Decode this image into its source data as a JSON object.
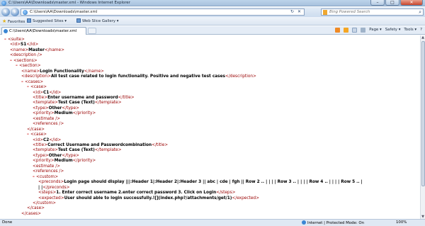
{
  "window": {
    "title": "C:\\Users\\AA\\Downloads\\master.xml - Windows Internet Explorer",
    "minimize": "–",
    "maximize": "□",
    "close": "✕"
  },
  "address": {
    "url": "C:\\Users\\AA\\Downloads\\master.xml",
    "refresh": "↻",
    "stop": "✕"
  },
  "search": {
    "placeholder": "Bing Powered Search"
  },
  "favorites": {
    "label": "Favorites",
    "suggested": "Suggested Sites ▾",
    "gallery": "Web Slice Gallery ▾"
  },
  "tab": {
    "label": "C:\\Users\\AA\\Downloads\\master.xml"
  },
  "commands": {
    "page": "Page ▾",
    "safety": "Safety ▾",
    "tools": "Tools ▾",
    "help": "?"
  },
  "xml": {
    "lines": [
      {
        "minus": "–",
        "indent": 0,
        "tag_open": "<suite>",
        "text": "",
        "tag_close": ""
      },
      {
        "minus": "",
        "indent": 1,
        "tag_open": "<id>",
        "text": "S1",
        "tag_close": "</id>"
      },
      {
        "minus": "",
        "indent": 1,
        "tag_open": "<name>",
        "text": "Master",
        "tag_close": "</name>"
      },
      {
        "minus": "",
        "indent": 1,
        "tag_open": "<description />",
        "text": "",
        "tag_close": ""
      },
      {
        "minus": "–",
        "indent": 1,
        "tag_open": "<sections>",
        "text": "",
        "tag_close": ""
      },
      {
        "minus": "–",
        "indent": 2,
        "tag_open": "<section>",
        "text": "",
        "tag_close": ""
      },
      {
        "minus": "",
        "indent": 3,
        "tag_open": "<name>",
        "text": "Login Functionality",
        "tag_close": "</name>"
      },
      {
        "minus": "",
        "indent": 3,
        "tag_open": "<description>",
        "text": "All test case related to login functionality. Positive and negative test cases",
        "tag_close": "</description>"
      },
      {
        "minus": "–",
        "indent": 3,
        "tag_open": "<cases>",
        "text": "",
        "tag_close": ""
      },
      {
        "minus": "–",
        "indent": 4,
        "tag_open": "<case>",
        "text": "",
        "tag_close": ""
      },
      {
        "minus": "",
        "indent": 5,
        "tag_open": "<id>",
        "text": "C1",
        "tag_close": "</id>"
      },
      {
        "minus": "",
        "indent": 5,
        "tag_open": "<title>",
        "text": "Enter username and password",
        "tag_close": "</title>"
      },
      {
        "minus": "",
        "indent": 5,
        "tag_open": "<template>",
        "text": "Test Case (Text)",
        "tag_close": "</template>"
      },
      {
        "minus": "",
        "indent": 5,
        "tag_open": "<type>",
        "text": "Other",
        "tag_close": "</type>"
      },
      {
        "minus": "",
        "indent": 5,
        "tag_open": "<priority>",
        "text": "Medium",
        "tag_close": "</priority>"
      },
      {
        "minus": "",
        "indent": 5,
        "tag_open": "<estimate />",
        "text": "",
        "tag_close": ""
      },
      {
        "minus": "",
        "indent": 5,
        "tag_open": "<references />",
        "text": "",
        "tag_close": ""
      },
      {
        "minus": "",
        "indent": 4,
        "tag_open": "</case>",
        "text": "",
        "tag_close": ""
      },
      {
        "minus": "–",
        "indent": 4,
        "tag_open": "<case>",
        "text": "",
        "tag_close": ""
      },
      {
        "minus": "",
        "indent": 5,
        "tag_open": "<id>",
        "text": "C2",
        "tag_close": "</id>"
      },
      {
        "minus": "",
        "indent": 5,
        "tag_open": "<title>",
        "text": "Correct Username and Passwordcombination",
        "tag_close": "</title>"
      },
      {
        "minus": "",
        "indent": 5,
        "tag_open": "<template>",
        "text": "Test Case (Text)",
        "tag_close": "</template>"
      },
      {
        "minus": "",
        "indent": 5,
        "tag_open": "<type>",
        "text": "Other",
        "tag_close": "</type>"
      },
      {
        "minus": "",
        "indent": 5,
        "tag_open": "<priority>",
        "text": "Medium",
        "tag_close": "</priority>"
      },
      {
        "minus": "",
        "indent": 5,
        "tag_open": "<estimate />",
        "text": "",
        "tag_close": ""
      },
      {
        "minus": "",
        "indent": 5,
        "tag_open": "<references />",
        "text": "",
        "tag_close": ""
      },
      {
        "minus": "–",
        "indent": 5,
        "tag_open": "<custom>",
        "text": "",
        "tag_close": ""
      },
      {
        "minus": "",
        "indent": 6,
        "tag_open": "<preconds>",
        "text": "Login page should display |||:Header 1|:Header 2|:Header 3 || abc | cde | fgh || Row 2 .. | | | | Row 3 .. | | | | Row 4 .. | | | | Row 5 .. |",
        "tag_close": ""
      },
      {
        "minus": "",
        "indent": 6,
        "tag_open": "",
        "text": "| |",
        "tag_close": "</preconds>"
      },
      {
        "minus": "",
        "indent": 6,
        "tag_open": "<steps>",
        "text": "1. Enter correct username 2.enter correct password 3. Click on Login",
        "tag_close": "</steps>"
      },
      {
        "minus": "",
        "indent": 6,
        "tag_open": "<expected>",
        "text": "User should able to login successfully.![](index.php?/attachments/get/1)",
        "tag_close": "</expected>"
      },
      {
        "minus": "",
        "indent": 5,
        "tag_open": "</custom>",
        "text": "",
        "tag_close": ""
      },
      {
        "minus": "",
        "indent": 4,
        "tag_open": "</case>",
        "text": "",
        "tag_close": ""
      },
      {
        "minus": "",
        "indent": 3,
        "tag_open": "</cases>",
        "text": "",
        "tag_close": ""
      }
    ]
  },
  "status": {
    "left": "Done",
    "zone": "Internet | Protected Mode: On",
    "zoom": "100%"
  }
}
